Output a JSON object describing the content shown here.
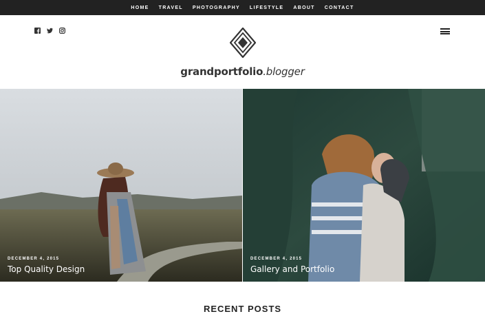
{
  "nav": {
    "items": [
      "HOME",
      "TRAVEL",
      "PHOTOGRAPHY",
      "LIFESTYLE",
      "ABOUT",
      "CONTACT"
    ]
  },
  "header": {
    "social_icons": [
      "facebook-icon",
      "twitter-icon",
      "instagram-icon"
    ],
    "brand_main": "grandportfolio",
    "brand_italic": ".blogger",
    "menu_icon": "hamburger-menu-icon"
  },
  "featured": [
    {
      "date": "DECEMBER 4, 2015",
      "title": "Top Quality Design"
    },
    {
      "date": "DECEMBER 4, 2015",
      "title": "Gallery and Portfolio"
    }
  ],
  "recent": {
    "heading": "RECENT POSTS"
  },
  "colors": {
    "nav_bg": "#222222",
    "text_dark": "#222222",
    "caption": "#ffffff"
  }
}
